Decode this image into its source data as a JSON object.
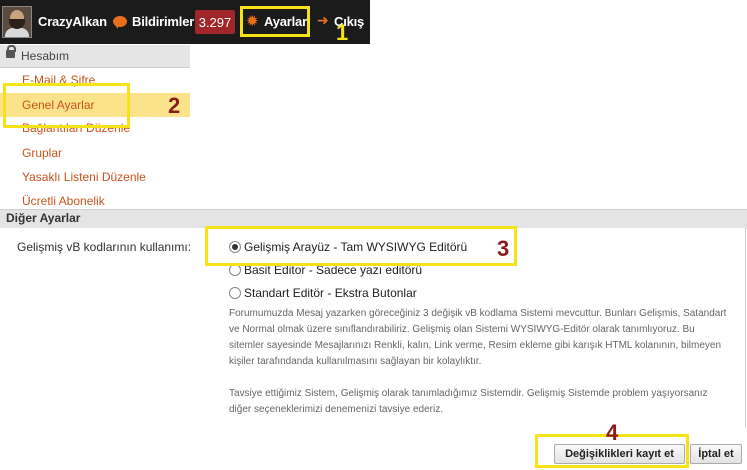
{
  "topbar": {
    "username": "CrazyAlkan",
    "notifications_label": "Bildirimler",
    "notifications_count": "3.297",
    "settings_label": "Ayarlar",
    "logout_label": "Çıkış"
  },
  "sidebar": {
    "header": "Hesabım",
    "items": [
      {
        "label": "E-Mail & Şifre"
      },
      {
        "label": "Genel Ayarlar"
      },
      {
        "label": "Bağlantıları Düzenle"
      },
      {
        "label": "Gruplar"
      },
      {
        "label": "Yasaklı Listeni Düzenle"
      },
      {
        "label": "Ücretli Abonelik"
      }
    ]
  },
  "section": {
    "title": "Diğer Ayarlar",
    "field_label": "Gelişmiş vB kodlarının kullanımı:",
    "options": [
      {
        "label": "Gelişmiş Arayüz - Tam WYSIWYG Editörü",
        "selected": true
      },
      {
        "label": "Basit Editor - Sadece yazı editörü",
        "selected": false
      },
      {
        "label": "Standart Editör - Ekstra Butonlar",
        "selected": false
      }
    ],
    "description_1": "Forumumuzda Mesaj yazarken göreceğiniz 3 değişik vB kodlama Sistemi mevcuttur. Bunları Gelişmis, Satandart ve Normal olmak üzere sınıflandırabiliriz. Gelişmiş olan Sistemi WYSIWYG-Editör olarak tanımlıyoruz. Bu sitemler sayesinde Mesajlarınızı Renkli, kalın, Link verme, Resim ekleme gibi karışık HTML kolanının, bilmeyen kişiler tarafındanda kullanılmasını sağlayan bir kolaylıktır.",
    "description_2": "Tavsiye ettiğimiz Sistem, Gelişmiş olarak tanımladığımız Sistemdir. Gelişmiş Sistemde problem yaşıyorsanız diğer seçeneklerimizi denemenizi tavsiye ederiz."
  },
  "buttons": {
    "save_label": "Değişiklikleri kayıt et",
    "cancel_label": "İptal et"
  },
  "annotations": {
    "step1": "1",
    "step2": "2",
    "step3": "3",
    "step4": "4"
  },
  "colors": {
    "accent": "#e8701a",
    "link": "#c8541c",
    "highlight_box": "#f5e316",
    "annotation_number_dark": "#8b1a1a",
    "annotation_number_yellow": "#f5e316",
    "badge": "#a0262a",
    "active_row": "#fbe38c"
  }
}
